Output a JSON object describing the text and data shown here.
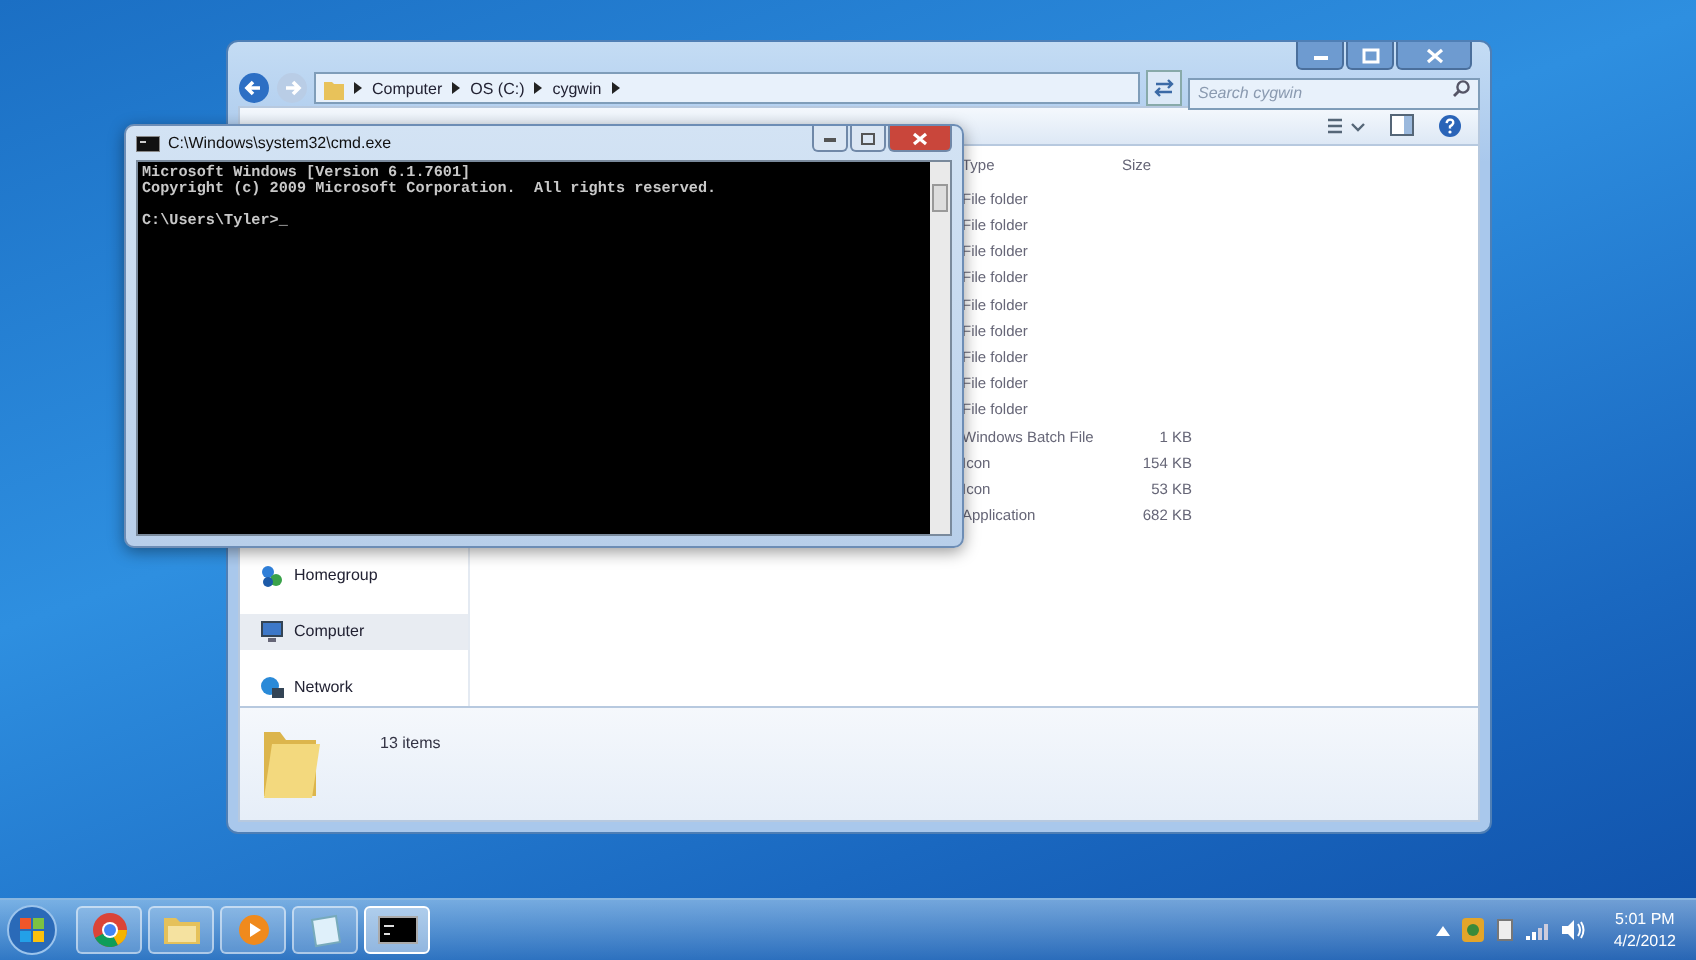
{
  "explorer": {
    "breadcrumb": [
      "Computer",
      "OS (C:)",
      "cygwin"
    ],
    "search": {
      "placeholder": "Search cygwin"
    },
    "columns": [
      "Type",
      "Size"
    ],
    "rows": [
      {
        "type": "File folder"
      },
      {
        "type": "File folder"
      },
      {
        "type": "File folder"
      },
      {
        "type": "File folder"
      },
      {
        "type": "File folder"
      },
      {
        "type": "File folder"
      },
      {
        "type": "File folder"
      },
      {
        "type": "File folder"
      },
      {
        "type": "File folder"
      },
      {
        "type": "Windows Batch File",
        "size": "1 KB"
      },
      {
        "type": "Icon",
        "size": "154 KB"
      },
      {
        "type": "Icon",
        "size": "53 KB"
      },
      {
        "type": "Application",
        "size": "682 KB"
      }
    ],
    "nav_items": [
      {
        "kind": "homegroup",
        "label": "Homegroup",
        "selected": false
      },
      {
        "kind": "computer",
        "label": "Computer",
        "selected": true
      },
      {
        "kind": "network",
        "label": "Network",
        "selected": false
      }
    ],
    "status": "13 items"
  },
  "cmd": {
    "title": "C:\\Windows\\system32\\cmd.exe",
    "output": [
      "Microsoft Windows [Version 6.1.7601]",
      "Copyright (c) 2009 Microsoft Corporation.  All rights reserved."
    ],
    "prompt": "C:\\Users\\Tyler>_"
  },
  "taskbar": {
    "items": [
      {
        "kind": "chrome",
        "active": false
      },
      {
        "kind": "folder",
        "active": false
      },
      {
        "kind": "media",
        "active": false
      },
      {
        "kind": "notepad",
        "active": false
      },
      {
        "kind": "console",
        "active": true
      }
    ],
    "clock": {
      "time": "5:01 PM",
      "date": "4/2/2012"
    }
  }
}
